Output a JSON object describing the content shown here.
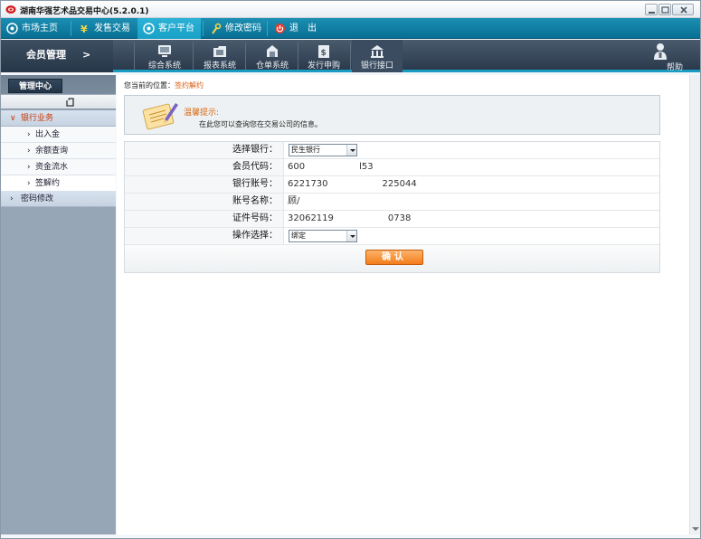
{
  "window": {
    "title": "湖南华强艺术品交易中心(5.2.0.1)"
  },
  "main_nav": {
    "tabs": [
      {
        "label": "市场主页",
        "icon": "globe-icon"
      },
      {
        "label": "发售交易",
        "icon": "yen-icon"
      },
      {
        "label": "客户平台",
        "icon": "globe-icon",
        "active": true
      },
      {
        "label": "修改密码",
        "icon": "key-icon"
      },
      {
        "label": "退　出",
        "icon": "power-icon"
      }
    ]
  },
  "sub_bar": {
    "section_title": "会员管理",
    "arrow": ">",
    "items": [
      {
        "label": "综合系统",
        "icon": "monitor-icon"
      },
      {
        "label": "报表系统",
        "icon": "folder-icon"
      },
      {
        "label": "仓单系统",
        "icon": "document-icon"
      },
      {
        "label": "发行申购",
        "icon": "certificate-icon"
      },
      {
        "label": "银行接口",
        "icon": "bank-icon",
        "active": true
      }
    ],
    "help_label": "帮助"
  },
  "sidebar": {
    "tab_label": "管理中心",
    "groups": [
      {
        "label": "银行业务",
        "expanded": true,
        "items": [
          "出入金",
          "余额查询",
          "资金流水",
          "签解约"
        ],
        "selected": "签解约"
      },
      {
        "label": "密码修改",
        "expanded": false
      }
    ]
  },
  "content": {
    "breadcrumb_prefix": "您当前的位置：",
    "breadcrumb_current": "签约解约",
    "tip_title": "温馨提示:",
    "tip_text": "在此您可以查询您在交易公司的信息。",
    "form": {
      "select_bank_label": "选择银行：",
      "select_bank_value": "民生银行",
      "member_code_label": "会员代码：",
      "member_code_value": "600　　　　　　l53",
      "bank_account_label": "银行账号：",
      "bank_account_value": "6221730　　　　　　225044",
      "account_name_label": "账号名称：",
      "account_name_value": "顾/",
      "id_number_label": "证件号码：",
      "id_number_value": "32062119　　　　　　0738",
      "operation_label": "操作选择：",
      "operation_value": "绑定",
      "confirm_label": "确认"
    }
  },
  "colors": {
    "nav_bg": "#0f80a6",
    "nav_active": "#22a8ce",
    "accent_orange": "#f47d1c",
    "sidebar_bg": "#97a6b7",
    "open_group_text": "#c8380a"
  }
}
